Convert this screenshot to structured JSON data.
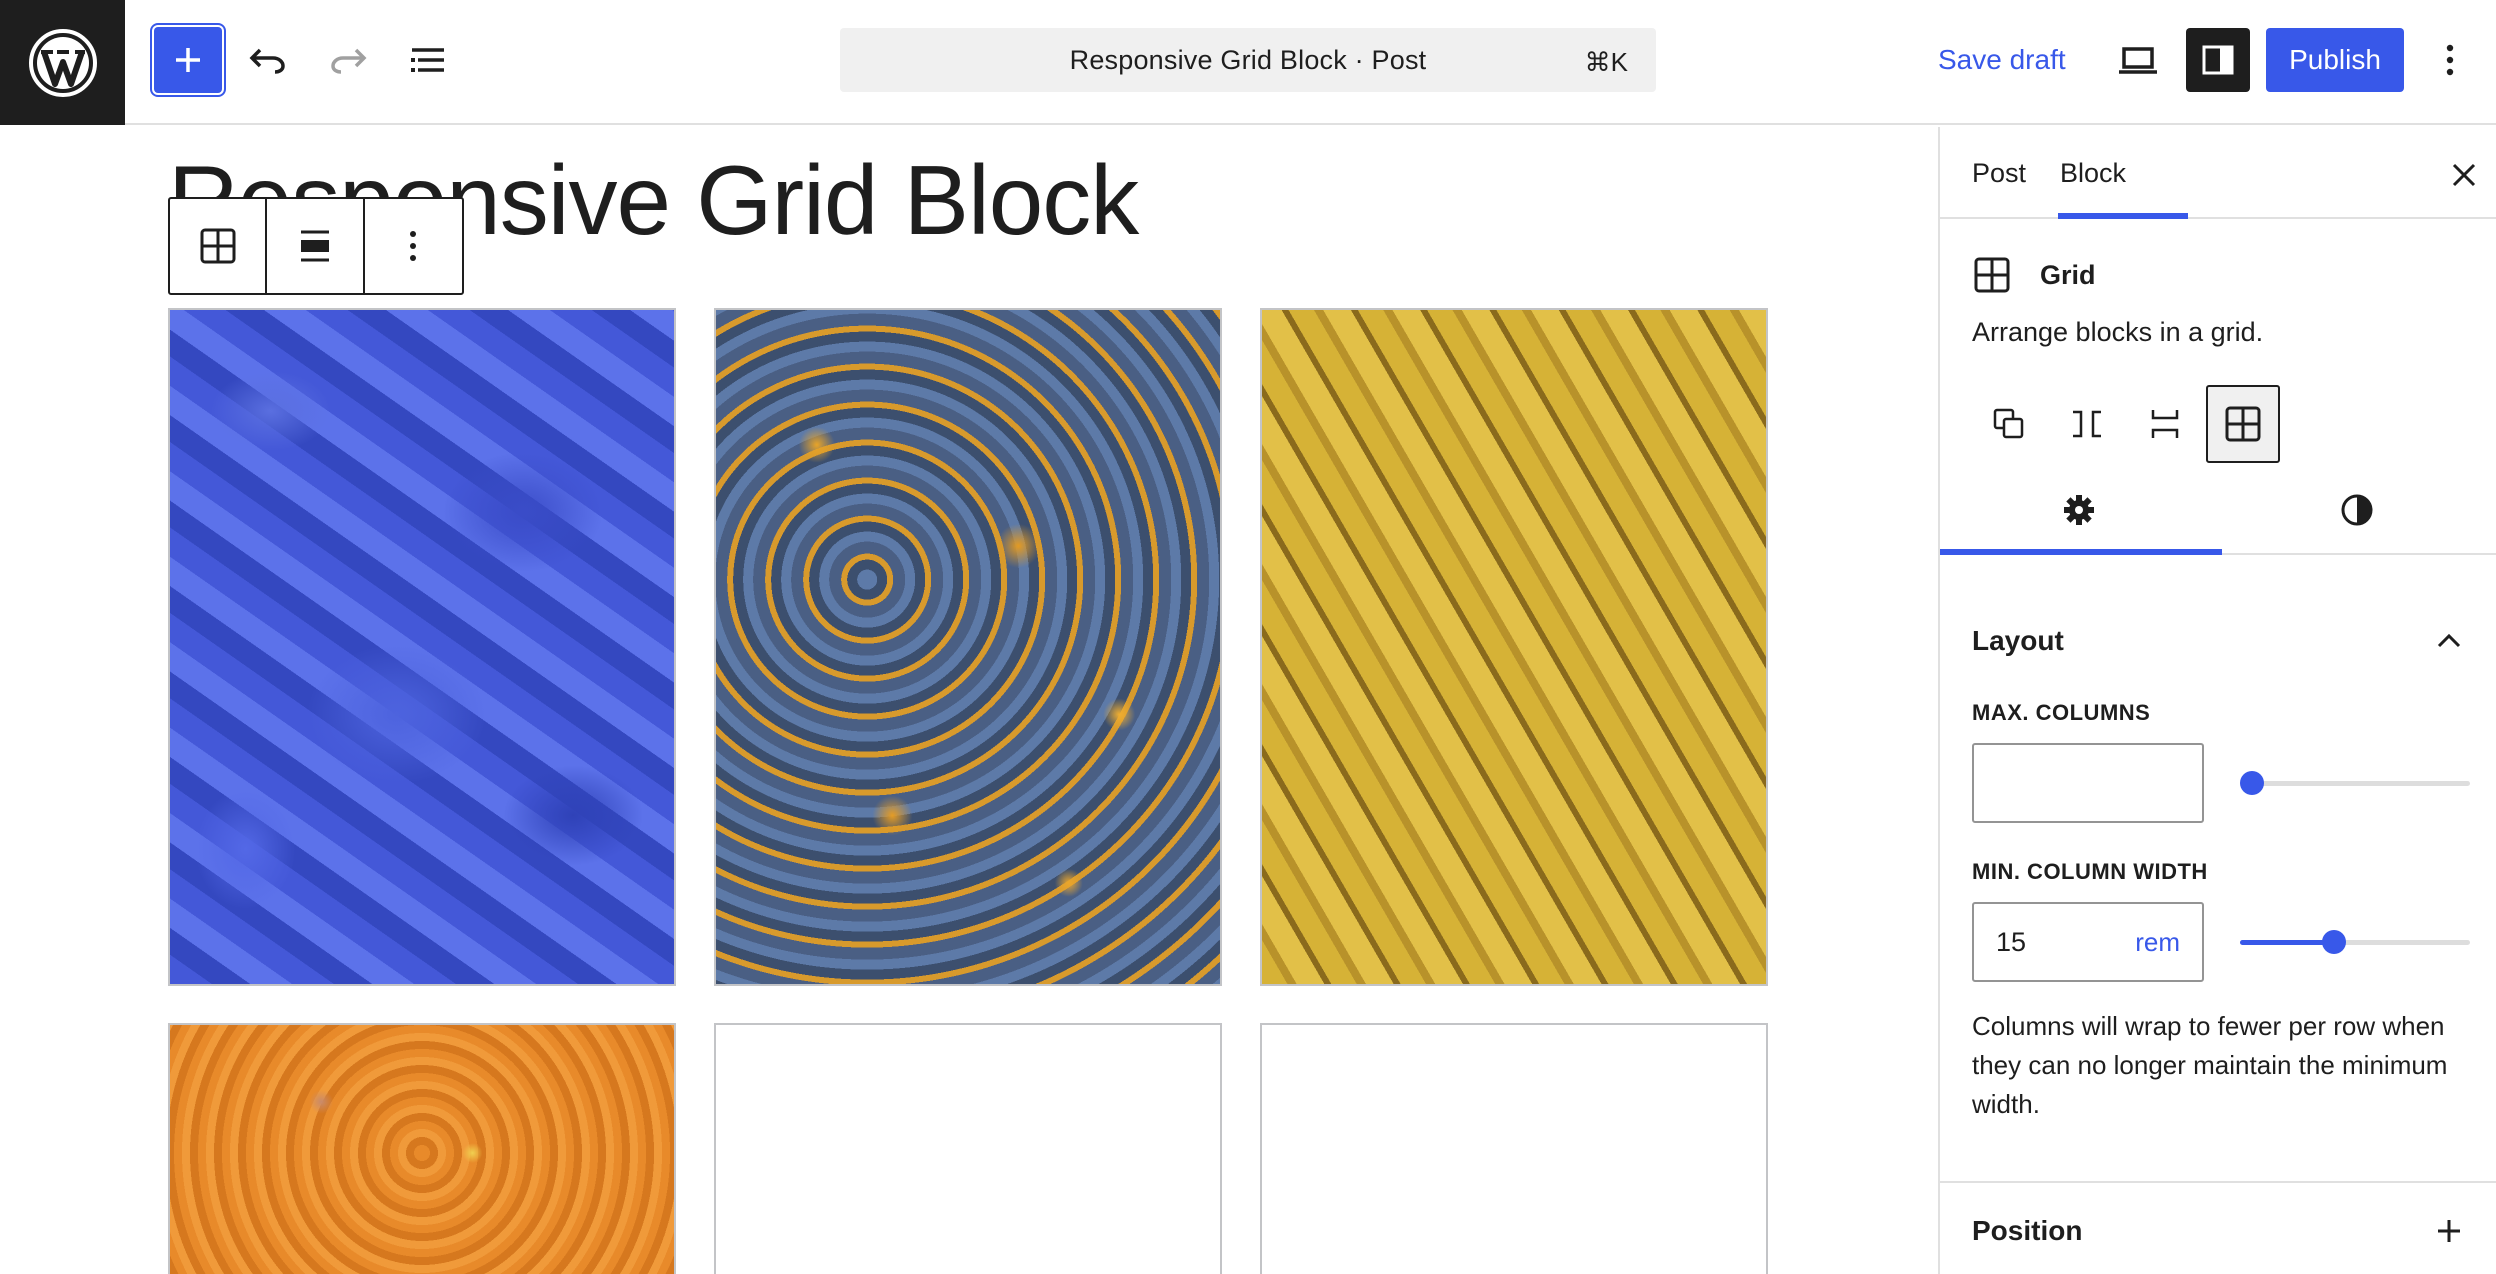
{
  "header": {
    "document_title": "Responsive Grid Block · Post",
    "shortcut": "⌘K",
    "save_draft_label": "Save draft",
    "publish_label": "Publish"
  },
  "editor": {
    "post_title": "Responsive Grid Block"
  },
  "sidebar": {
    "tabs": [
      {
        "label": "Post",
        "active": false
      },
      {
        "label": "Block",
        "active": true
      }
    ],
    "block": {
      "name": "Grid",
      "description": "Arrange blocks in a grid."
    },
    "layout": {
      "title": "Layout",
      "max_columns_label": "MAX. COLUMNS",
      "max_columns_value": "",
      "min_column_width_label": "MIN. COLUMN WIDTH",
      "min_column_width_value": "15",
      "min_column_width_unit": "rem",
      "help_text": "Columns will wrap to fewer per row when they can no longer maintain the minimum width."
    },
    "position": {
      "title": "Position"
    }
  },
  "colors": {
    "accent": "#3858e9",
    "dark": "#1e1e1e"
  }
}
